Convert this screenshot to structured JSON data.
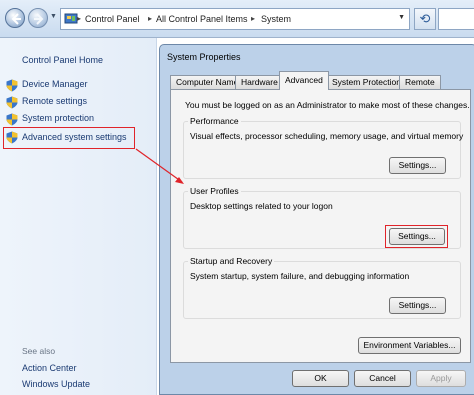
{
  "address_bar": {
    "crumbs": [
      "Control Panel",
      "All Control Panel Items",
      "System"
    ]
  },
  "left_pane": {
    "home": "Control Panel Home",
    "tasks": [
      {
        "label": "Device Manager",
        "icon": "shield-icon"
      },
      {
        "label": "Remote settings",
        "icon": "shield-icon"
      },
      {
        "label": "System protection",
        "icon": "shield-icon"
      },
      {
        "label": "Advanced system settings",
        "icon": "shield-icon",
        "highlighted": true
      }
    ],
    "see_also": "See also",
    "see_also_links": [
      "Action Center",
      "Windows Update"
    ]
  },
  "dialog": {
    "title": "System Properties",
    "tabs": [
      {
        "label": "Computer Name"
      },
      {
        "label": "Hardware"
      },
      {
        "label": "Advanced",
        "active": true
      },
      {
        "label": "System Protection"
      },
      {
        "label": "Remote"
      }
    ],
    "admin_note": "You must be logged on as an Administrator to make most of these changes.",
    "groups": [
      {
        "title": "Performance",
        "description": "Visual effects, processor scheduling, memory usage, and virtual memory",
        "button": "Settings..."
      },
      {
        "title": "User Profiles",
        "description": "Desktop settings related to your logon",
        "button": "Settings...",
        "highlighted": true
      },
      {
        "title": "Startup and Recovery",
        "description": "System startup, system failure, and debugging information",
        "button": "Settings..."
      }
    ],
    "env_button": "Environment Variables...",
    "ok": "OK",
    "cancel": "Cancel",
    "apply": "Apply"
  },
  "colors": {
    "highlight": "#e0242a",
    "link": "#1a3a72",
    "dialog_frame": "#bcd1e9"
  }
}
